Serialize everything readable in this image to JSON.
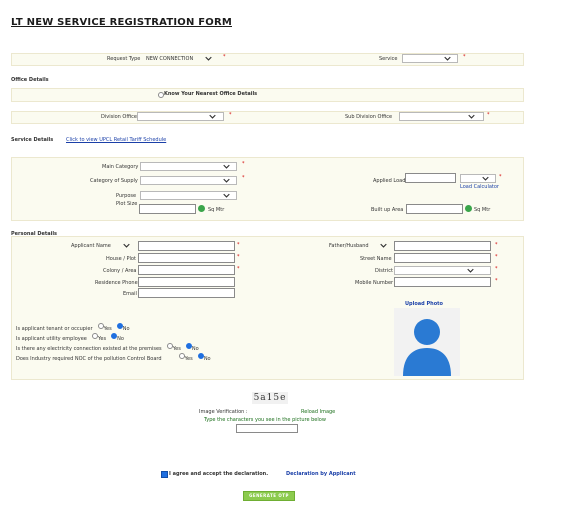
{
  "page_title": "LT NEW SERVICE REGISTRATION FORM",
  "request_type": {
    "label": "Request Type",
    "value": "NEW CONNECTION"
  },
  "service": {
    "label": "Service",
    "value": ""
  },
  "office_details": {
    "heading": "Office Details",
    "know_office": "Know Your Nearest Office Details",
    "division_label": "Division Office",
    "sub_division_label": "Sub Division Office"
  },
  "service_details": {
    "heading": "Service Details",
    "tariff_link": "Click to view UPCL Retail Tariff Schedule",
    "main_category": "Main Category",
    "category_of_supply": "Category of Supply",
    "purpose": "Purpose",
    "plot_size": "Plot Size",
    "unit1": "Sq Mtr",
    "applied_load": "Applied Load",
    "load_calculator": "Load Calculator",
    "built_up_area": "Built up Area",
    "unit2": "Sq Mtr"
  },
  "personal_details": {
    "heading": "Personal Details",
    "applicant_name": "Applicant Name",
    "house_plot": "House / Plot",
    "colony_area": "Colony / Area",
    "residence_phone": "Residence Phone",
    "email": "Email",
    "father_husband": "Father/Husband",
    "street_name": "Street Name",
    "district": "District",
    "mobile_number": "Mobile Number",
    "upload_photo": "Upload Photo"
  },
  "questions": [
    {
      "text": "Is applicant tenant or occupier",
      "yes": "Yes",
      "no": "No",
      "selected": "no"
    },
    {
      "text": "Is applicant utility employee",
      "yes": "Yes",
      "no": "No",
      "selected": "no"
    },
    {
      "text": "Is there any electricity connection existed at the premises",
      "yes": "Yes",
      "no": "No",
      "selected": "no"
    },
    {
      "text": "Does Industry required NOC of the pollution Control Board",
      "yes": "Yes",
      "no": "No",
      "selected": "no"
    }
  ],
  "captcha": {
    "code": "5a15e",
    "image_verification": "Image Verification :",
    "reload": "Reload Image",
    "instruction": "Type the characters you see in the picture below"
  },
  "declaration": {
    "text": "I agree and accept the declaration.",
    "link": "Declaration by Applicant"
  },
  "generate_otp": "GENERATE OTP",
  "colors": {
    "accent_blue": "#1f6fe0",
    "button_green": "#8ccb4e",
    "required_red": "#d40000"
  }
}
